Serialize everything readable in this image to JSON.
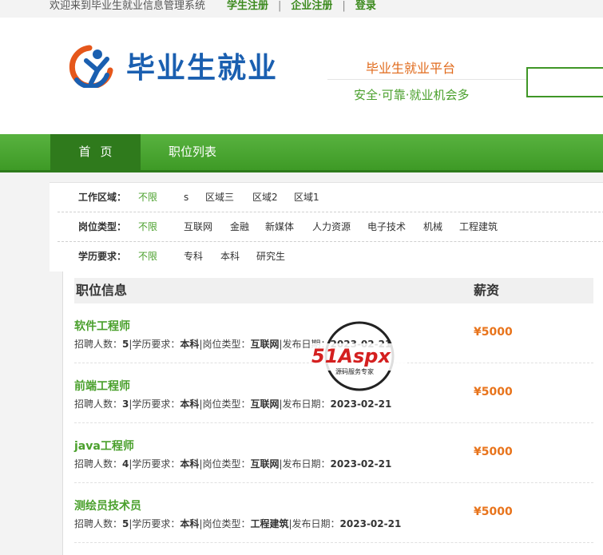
{
  "topbar": {
    "welcome": "欢迎来到毕业生就业信息管理系统",
    "links": [
      {
        "label": "学生注册"
      },
      {
        "label": "企业注册"
      },
      {
        "label": "登录"
      }
    ]
  },
  "header": {
    "logo_text": "毕业生就业",
    "slogan_main": "毕业生就业平台",
    "slogan_sub": "安全·可靠·就业机会多",
    "search_placeholder": ""
  },
  "nav": {
    "items": [
      {
        "label": "首页"
      },
      {
        "label": "职位列表"
      }
    ]
  },
  "filters": [
    {
      "label": "工作区域：",
      "options": [
        "不限",
        "s",
        "区域三",
        "区域2",
        "区域1"
      ]
    },
    {
      "label": "岗位类型：",
      "options": [
        "不限",
        "互联网",
        "金融",
        "新媒体",
        "人力资源",
        "电子技术",
        "机械",
        "工程建筑"
      ]
    },
    {
      "label": "学历要求：",
      "options": [
        "不限",
        "专科",
        "本科",
        "研究生"
      ]
    }
  ],
  "joblist": {
    "header_info": "职位信息",
    "header_salary": "薪资",
    "jobs": [
      {
        "title": "软件工程师",
        "count_label": "招聘人数：",
        "count": "5",
        "edu_label": "|学历要求：",
        "edu": "本科",
        "type_label": "|岗位类型：",
        "type": "互联网",
        "date_label": "|发布日期：",
        "date": "2023-02-21",
        "salary": "¥5000"
      },
      {
        "title": "前端工程师",
        "count_label": "招聘人数：",
        "count": "3",
        "edu_label": "|学历要求：",
        "edu": "本科",
        "type_label": "|岗位类型：",
        "type": "互联网",
        "date_label": "|发布日期：",
        "date": "2023-02-21",
        "salary": "¥5000"
      },
      {
        "title": "java工程师",
        "count_label": "招聘人数：",
        "count": "4",
        "edu_label": "|学历要求：",
        "edu": "本科",
        "type_label": "|岗位类型：",
        "type": "互联网",
        "date_label": "|发布日期：",
        "date": "2023-02-21",
        "salary": "¥5000"
      },
      {
        "title": "测绘员技术员",
        "count_label": "招聘人数：",
        "count": "5",
        "edu_label": "|学历要求：",
        "edu": "本科",
        "type_label": "|岗位类型：",
        "type": "工程建筑",
        "date_label": "|发布日期：",
        "date": "2023-02-21",
        "salary": "¥5000"
      }
    ]
  },
  "watermark": {
    "brand": "51Aspx",
    "sub": "源码服务专家"
  },
  "colors": {
    "green": "#4aa02c",
    "orange": "#e8741c",
    "blue": "#1a5fb0"
  }
}
